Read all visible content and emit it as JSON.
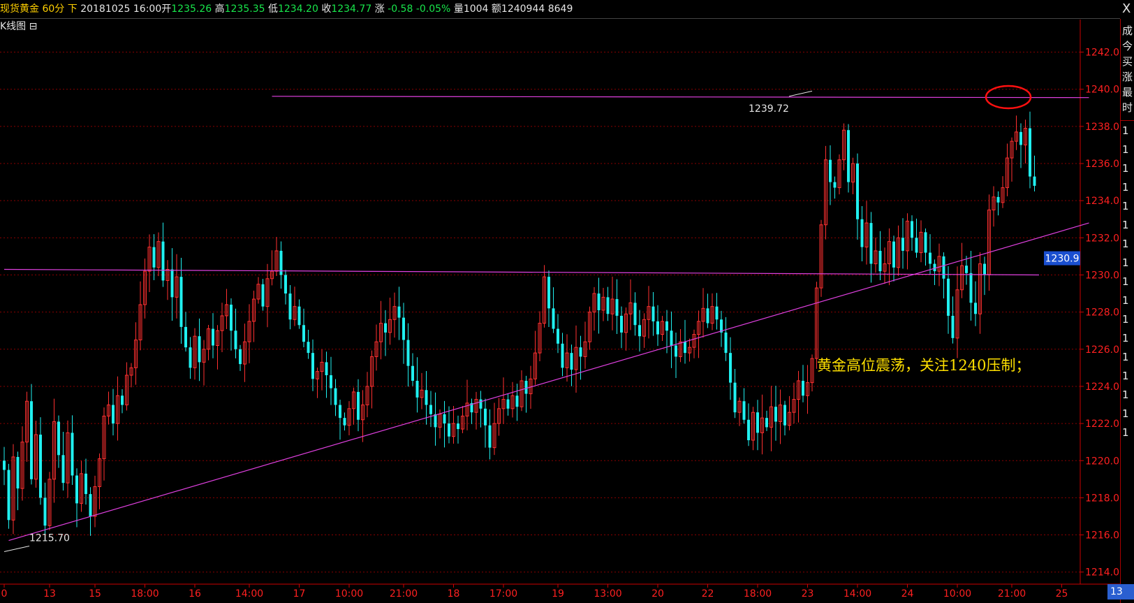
{
  "header": {
    "product": "现货黄金",
    "period": "60分",
    "direction": "下",
    "datetime": "20181025 16:00",
    "open_label": "开",
    "open": "1235.26",
    "high_label": "高",
    "high": "1235.35",
    "low_label": "低",
    "low": "1234.20",
    "close_label": "收",
    "close": "1234.77",
    "change_label": "涨",
    "change": "-0.58",
    "change_pct": "-0.05%",
    "volume_label": "量",
    "volume": "1004",
    "amount_label": "额",
    "amount": "1240944",
    "extra": "8649"
  },
  "subheader": {
    "label": "K线图",
    "toggle": "⊟"
  },
  "close_button": "X",
  "right_panel": [
    "成",
    "今",
    "买",
    "涨",
    "最",
    "时",
    "1",
    "1",
    "1",
    "1",
    "1",
    "1",
    "1",
    "1",
    "1",
    "1",
    "1",
    "1",
    "1",
    "1",
    "1",
    "1",
    "1"
  ],
  "time_corner": "13",
  "colors": {
    "up": "#ff3030",
    "down": "#20f0f0",
    "trend": "#e040e0",
    "grid": "#8b0000",
    "axis_text": "#ff2020",
    "annotation": "#ffe000"
  },
  "chart_data": {
    "type": "candlestick",
    "ylim": [
      1213.5,
      1243
    ],
    "y_ticks": [
      1242.0,
      1240.0,
      1238.0,
      1236.0,
      1234.0,
      1232.0,
      1230.0,
      1228.0,
      1226.0,
      1224.0,
      1222.0,
      1220.0,
      1218.0,
      1216.0,
      1214.0
    ],
    "y_tick_labels": [
      "1242.0",
      "1240.0",
      "1238.0",
      "1236.0",
      "1234.0",
      "1232.0",
      "1230.0",
      "1228.0",
      "1226.0",
      "1224.0",
      "1222.0",
      "1220.0",
      "1218.0",
      "1216.0",
      "1214.0"
    ],
    "x_tick_labels": [
      "0",
      "13",
      "15",
      "18:00",
      "16",
      "14:00",
      "17",
      "10:00",
      "21:00",
      "18",
      "17:00",
      "19",
      "13:00",
      "20",
      "22",
      "18:00",
      "23",
      "14:00",
      "24",
      "10:00",
      "21:00",
      "25"
    ],
    "x_tick_index": [
      0,
      10,
      20,
      31,
      42,
      54,
      65,
      76,
      88,
      99,
      110,
      122,
      133,
      144,
      155,
      166,
      177,
      188,
      199,
      210,
      222,
      233
    ],
    "current_price": "1230.9",
    "annotations": {
      "low_mark": "1215.70",
      "high_mark": "1239.72",
      "comment": "黄金高位震荡，关注1240压制；"
    },
    "closes": [
      1219.5,
      1216.8,
      1220.2,
      1218.5,
      1221.0,
      1223.2,
      1219.0,
      1221.4,
      1218.0,
      1216.5,
      1219.0,
      1222.1,
      1220.3,
      1218.8,
      1221.5,
      1219.2,
      1217.7,
      1219.3,
      1218.2,
      1217.0,
      1218.6,
      1220.1,
      1222.4,
      1223.0,
      1222.0,
      1223.5,
      1223.0,
      1224.6,
      1225.0,
      1226.5,
      1228.4,
      1230.2,
      1231.5,
      1230.4,
      1231.8,
      1229.7,
      1230.3,
      1228.8,
      1229.9,
      1227.2,
      1226.1,
      1225.0,
      1226.7,
      1225.3,
      1226.0,
      1227.1,
      1226.2,
      1227.0,
      1227.8,
      1228.4,
      1227.0,
      1226.0,
      1225.2,
      1226.4,
      1227.5,
      1228.7,
      1229.5,
      1228.3,
      1229.8,
      1230.2,
      1231.3,
      1230.0,
      1229.0,
      1227.6,
      1228.3,
      1227.3,
      1226.4,
      1225.8,
      1224.4,
      1224.8,
      1225.3,
      1224.6,
      1223.9,
      1223.0,
      1222.3,
      1221.9,
      1222.8,
      1223.7,
      1222.2,
      1223.0,
      1224.0,
      1225.6,
      1226.4,
      1227.4,
      1226.9,
      1227.6,
      1228.3,
      1227.7,
      1226.5,
      1225.1,
      1224.3,
      1223.4,
      1223.8,
      1223.0,
      1222.5,
      1221.8,
      1222.5,
      1222.0,
      1221.3,
      1222.0,
      1221.7,
      1222.4,
      1223.1,
      1222.6,
      1223.3,
      1222.8,
      1221.9,
      1220.7,
      1222.0,
      1222.8,
      1223.3,
      1222.8,
      1223.5,
      1222.9,
      1224.3,
      1223.6,
      1224.4,
      1225.8,
      1227.4,
      1229.9,
      1228.2,
      1227.1,
      1226.3,
      1225.0,
      1225.8,
      1224.9,
      1226.1,
      1225.6,
      1226.4,
      1228.0,
      1229.0,
      1228.1,
      1228.8,
      1227.9,
      1228.7,
      1227.8,
      1226.9,
      1227.9,
      1228.5,
      1227.3,
      1226.7,
      1227.6,
      1228.3,
      1227.5,
      1226.8,
      1227.5,
      1227.0,
      1226.2,
      1225.6,
      1226.4,
      1225.8,
      1226.1,
      1226.8,
      1227.5,
      1228.2,
      1227.4,
      1228.3,
      1227.6,
      1226.9,
      1225.8,
      1224.2,
      1222.6,
      1223.2,
      1222.2,
      1221.1,
      1222.6,
      1221.5,
      1222.3,
      1221.8,
      1222.9,
      1222.1,
      1223.0,
      1221.9,
      1222.6,
      1223.3,
      1224.3,
      1223.5,
      1224.2,
      1225.5,
      1229.3,
      1232.7,
      1236.2,
      1235.0,
      1234.7,
      1236.2,
      1237.8,
      1235.0,
      1236.0,
      1233.0,
      1231.5,
      1232.8,
      1230.6,
      1231.3,
      1230.2,
      1230.6,
      1231.8,
      1230.4,
      1232.0,
      1231.3,
      1232.9,
      1232.0,
      1231.2,
      1232.3,
      1231.2,
      1230.6,
      1230.2,
      1231.0,
      1229.8,
      1227.8,
      1226.6,
      1229.2,
      1230.5,
      1230.1,
      1228.5,
      1227.9,
      1230.6,
      1230.0,
      1233.5,
      1234.2,
      1233.9,
      1234.7,
      1236.3,
      1237.2,
      1237.7,
      1237.0,
      1237.9,
      1235.3,
      1234.8
    ],
    "trendlines": [
      {
        "name": "support",
        "from": [
          1,
          1215.7
        ],
        "to": [
          239,
          1232.8
        ]
      },
      {
        "name": "neckline",
        "from": [
          0,
          1230.3
        ],
        "to": [
          228,
          1230.0
        ]
      },
      {
        "name": "resistance",
        "from": [
          59,
          1239.62
        ],
        "to": [
          239,
          1239.55
        ]
      }
    ]
  }
}
